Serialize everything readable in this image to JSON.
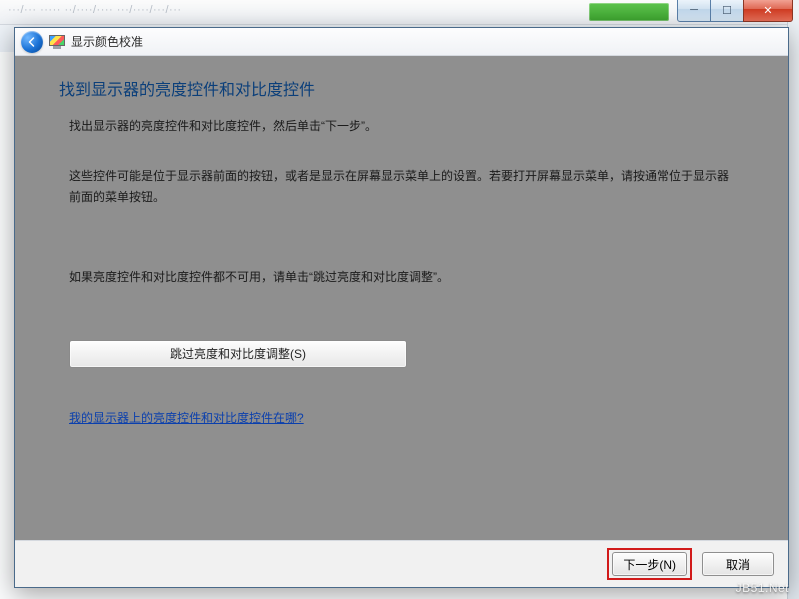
{
  "browser": {
    "window_controls": {
      "min": "─",
      "max": "☐",
      "close": "✕"
    },
    "address_faded": "···/··· ·····  ··/····/···· ···/····/···/···"
  },
  "wizard": {
    "header_title": "显示颜色校准",
    "heading": "找到显示器的亮度控件和对比度控件",
    "paragraph1": "找出显示器的亮度控件和对比度控件，然后单击“下一步”。",
    "paragraph2": "这些控件可能是位于显示器前面的按钮，或者是显示在屏幕显示菜单上的设置。若要打开屏幕显示菜单，请按通常位于显示器前面的菜单按钮。",
    "paragraph3": "如果亮度控件和对比度控件都不可用，请单击“跳过亮度和对比度调整”。",
    "skip_button": "跳过亮度和对比度调整(S)",
    "help_link": "我的显示器上的亮度控件和对比度控件在哪?",
    "next_button": "下一步(N)",
    "cancel_button": "取消"
  },
  "watermark": "JB51.Net"
}
